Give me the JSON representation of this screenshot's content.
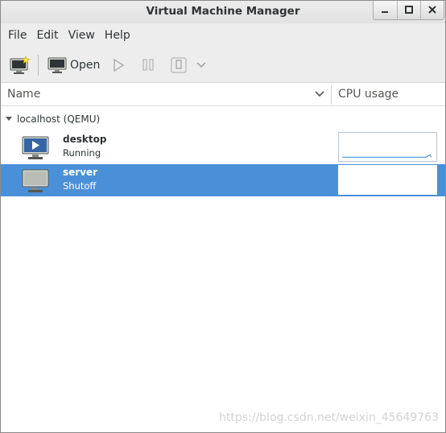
{
  "window": {
    "title": "Virtual Machine Manager"
  },
  "menubar": {
    "items": [
      "File",
      "Edit",
      "View",
      "Help"
    ]
  },
  "toolbar": {
    "open_label": "Open",
    "buttons": [
      "new-vm-icon",
      "open-console-icon",
      "run-icon",
      "pause-icon",
      "shutdown-icon",
      "shutdown-menu-chevron-icon"
    ]
  },
  "list": {
    "columns": {
      "name": "Name",
      "cpu": "CPU usage"
    },
    "connection": {
      "label": "localhost (QEMU)",
      "expanded": true
    },
    "vms": [
      {
        "name": "desktop",
        "status": "Running",
        "selected": false,
        "icon": "vm-running-icon"
      },
      {
        "name": "server",
        "status": "Shutoff",
        "selected": true,
        "icon": "vm-shutoff-icon"
      }
    ]
  },
  "watermark": "https://blog.csdn.net/weixin_45649763",
  "colors": {
    "selection": "#4a90d9",
    "graph_line": "#4a90d9",
    "chrome": "#ededed"
  }
}
